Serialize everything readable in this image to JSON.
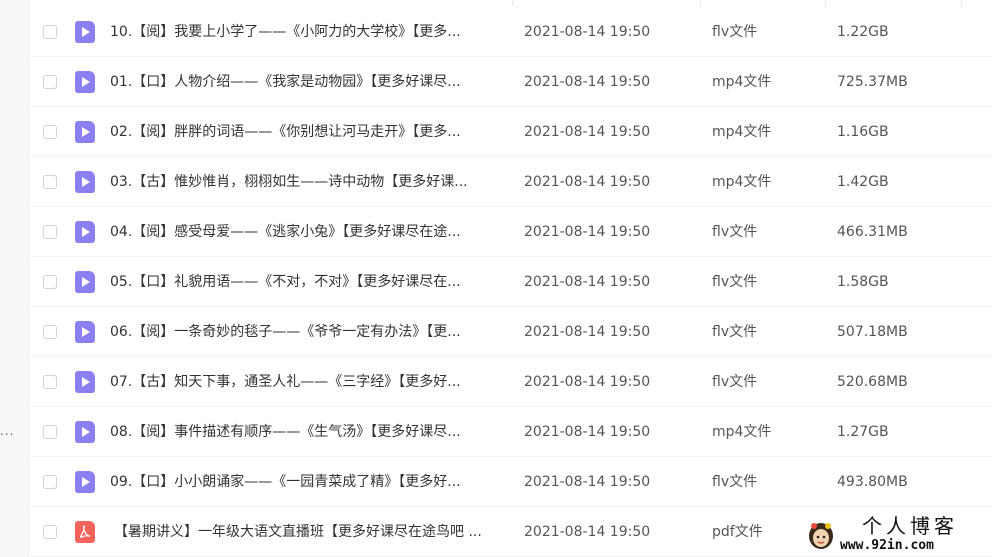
{
  "files": [
    {
      "name": "10.【阅】我要上小学了——《小阿力的大学校》【更多...",
      "date": "2021-08-14 19:50",
      "type": "flv文件",
      "size": "1.22GB",
      "icon": "video-file-icon"
    },
    {
      "name": "01.【口】人物介绍——《我家是动物园》【更多好课尽...",
      "date": "2021-08-14 19:50",
      "type": "mp4文件",
      "size": "725.37MB",
      "icon": "video-file-icon"
    },
    {
      "name": "02.【阅】胖胖的词语——《你别想让河马走开》【更多...",
      "date": "2021-08-14 19:50",
      "type": "mp4文件",
      "size": "1.16GB",
      "icon": "video-file-icon"
    },
    {
      "name": "03.【古】惟妙惟肖，栩栩如生——诗中动物【更多好课...",
      "date": "2021-08-14 19:50",
      "type": "mp4文件",
      "size": "1.42GB",
      "icon": "video-file-icon"
    },
    {
      "name": "04.【阅】感受母爱——《逃家小兔》【更多好课尽在途...",
      "date": "2021-08-14 19:50",
      "type": "flv文件",
      "size": "466.31MB",
      "icon": "video-file-icon"
    },
    {
      "name": "05.【口】礼貌用语——《不对，不对》【更多好课尽在...",
      "date": "2021-08-14 19:50",
      "type": "flv文件",
      "size": "1.58GB",
      "icon": "video-file-icon"
    },
    {
      "name": "06.【阅】一条奇妙的毯子——《爷爷一定有办法》【更...",
      "date": "2021-08-14 19:50",
      "type": "flv文件",
      "size": "507.18MB",
      "icon": "video-file-icon"
    },
    {
      "name": "07.【古】知天下事，通圣人礼——《三字经》【更多好...",
      "date": "2021-08-14 19:50",
      "type": "flv文件",
      "size": "520.68MB",
      "icon": "video-file-icon"
    },
    {
      "name": "08.【阅】事件描述有顺序——《生气汤》【更多好课尽...",
      "date": "2021-08-14 19:50",
      "type": "mp4文件",
      "size": "1.27GB",
      "icon": "video-file-icon"
    },
    {
      "name": "09.【口】小小朗诵家——《一园青菜成了精》【更多好...",
      "date": "2021-08-14 19:50",
      "type": "flv文件",
      "size": "493.80MB",
      "icon": "video-file-icon"
    },
    {
      "name": "【暑期讲义】一年级大语文直播班【更多好课尽在途鸟吧 ...",
      "date": "2021-08-14 19:50",
      "type": "pdf文件",
      "size": "",
      "icon": "pdf-file-icon"
    }
  ],
  "sidebar": {
    "dots": "..."
  },
  "watermark": {
    "title": "个人博客",
    "url": "www.92in.com"
  },
  "colors": {
    "video_icon": "#8c7ff2",
    "pdf_icon": "#f5645c",
    "row_divider": "#f1f2f5"
  }
}
